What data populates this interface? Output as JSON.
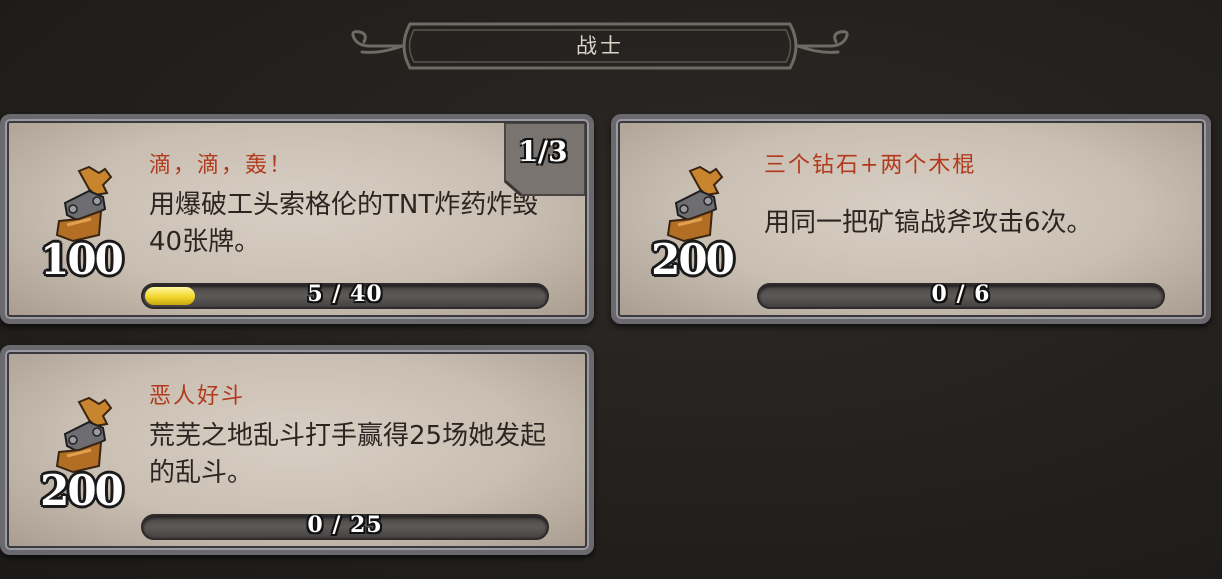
{
  "header": {
    "title": "战士"
  },
  "quests": [
    {
      "title": "滴，滴，轰！",
      "description": "用爆破工头索格伦的TNT炸药炸毁40张牌。",
      "reward": "100",
      "step": "1/3",
      "progress_text": "5 / 40",
      "progress_fraction": 0.125
    },
    {
      "title": "三个钻石+两个木棍",
      "description": "用同一把矿镐战斧攻击6次。",
      "reward": "200",
      "progress_text": "0 / 6",
      "progress_fraction": 0
    },
    {
      "title": "恶人好斗",
      "description": "荒芜之地乱斗打手赢得25场她发起的乱斗。",
      "reward": "200",
      "progress_text": "0 / 25",
      "progress_fraction": 0
    }
  ],
  "colors": {
    "title_red": "#b23a1c",
    "progress_yellow": "#f2d62c",
    "card_parchment": "#d2c8bc"
  },
  "icons": {
    "reward": "reward-pouch-icon"
  }
}
